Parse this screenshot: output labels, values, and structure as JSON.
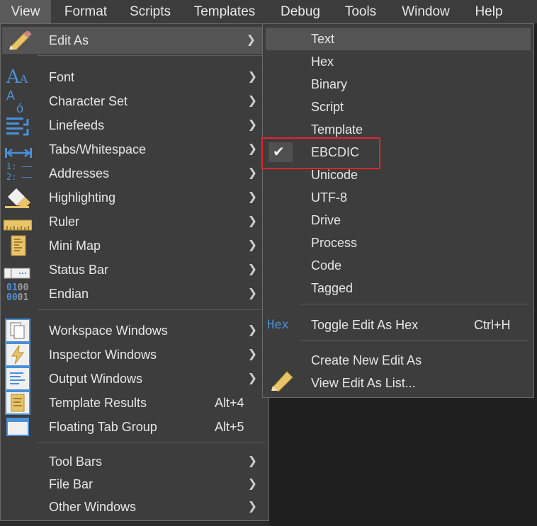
{
  "menubar": [
    "View",
    "Format",
    "Scripts",
    "Templates",
    "Debug",
    "Tools",
    "Window",
    "Help"
  ],
  "view_menu": {
    "edit_as": "Edit As",
    "group1": [
      "Font",
      "Character Set",
      "Linefeeds",
      "Tabs/Whitespace",
      "Addresses",
      "Highlighting",
      "Ruler",
      "Mini Map",
      "Status Bar",
      "Endian"
    ],
    "group2": [
      {
        "label": "Workspace Windows",
        "shortcut": ""
      },
      {
        "label": "Inspector Windows",
        "shortcut": ""
      },
      {
        "label": "Output Windows",
        "shortcut": ""
      },
      {
        "label": "Template Results",
        "shortcut": "Alt+4"
      },
      {
        "label": "Floating Tab Group",
        "shortcut": "Alt+5"
      }
    ],
    "group3": [
      "Tool Bars",
      "File Bar",
      "Other Windows"
    ]
  },
  "edit_as_menu": {
    "modes": [
      "Text",
      "Hex",
      "Binary",
      "Script",
      "Template",
      "EBCDIC",
      "Unicode",
      "UTF-8",
      "Drive",
      "Process",
      "Code",
      "Tagged"
    ],
    "checked": "EBCDIC",
    "hex_icon": "Hex",
    "toggle": {
      "label": "Toggle Edit As Hex",
      "shortcut": "Ctrl+H"
    },
    "create": "Create New Edit As",
    "view_list": "View Edit As List..."
  },
  "colors": {
    "highlight_box": "#e0262b",
    "icon_blue": "#4a90d9",
    "icon_yellow": "#e8c46a"
  }
}
